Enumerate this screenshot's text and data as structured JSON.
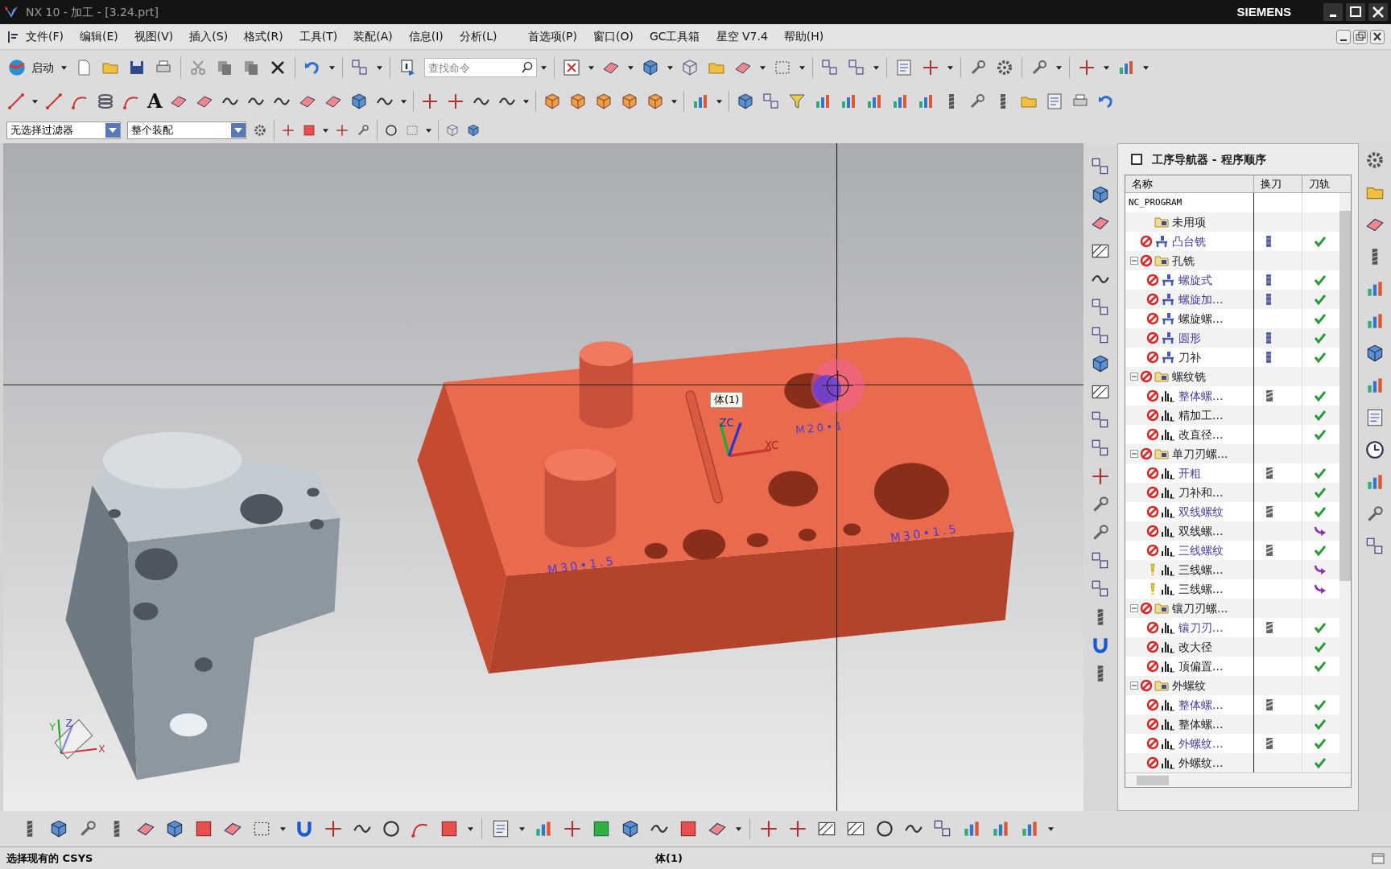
{
  "window": {
    "title": "NX 10 - 加工 - [3.24.prt]",
    "brand": "SIEMENS"
  },
  "menu": [
    "文件(F)",
    "编辑(E)",
    "视图(V)",
    "插入(S)",
    "格式(R)",
    "工具(T)",
    "装配(A)",
    "信息(I)",
    "分析(L)",
    "首选项(P)",
    "窗口(O)",
    "GC工具箱",
    "星空 V7.4",
    "帮助(H)"
  ],
  "toolbar": {
    "start_button": "启动",
    "search": {
      "placeholder": "查找命令"
    },
    "text_tool": "A"
  },
  "selection_bar": {
    "filter": "无选择过滤器",
    "scope": "整个装配"
  },
  "viewport": {
    "tooltip": "体(1)",
    "thread_labels": [
      "M30•1.5",
      "M20•1",
      "M30•1.5"
    ],
    "wcs_labels": [
      "ZC",
      "XC"
    ],
    "triad_labels": [
      "Z",
      "Y",
      "X"
    ]
  },
  "navigator": {
    "title": "工序导航器 - 程序顺序",
    "columns": [
      "名称",
      "换刀",
      "刀轨"
    ],
    "tree": [
      {
        "name": "NC_PROGRAM",
        "kind": "root",
        "children": [
          {
            "name": "未用项",
            "kind": "group",
            "error": false,
            "warning": false,
            "color": "#222222"
          },
          {
            "name": "凸台铣",
            "kind": "mill",
            "error": true,
            "warning": false,
            "tool_change": true,
            "path_ok": true,
            "color": "#4a3d9c"
          },
          {
            "name": "孔铣",
            "kind": "group",
            "error": true,
            "warning": false,
            "expanded": true,
            "color": "#222222",
            "children": [
              {
                "name": "螺旋式",
                "kind": "mill",
                "error": true,
                "warning": false,
                "tool_change": true,
                "path_ok": true,
                "color": "#4a3d9c"
              },
              {
                "name": "螺旋加...",
                "kind": "mill",
                "error": true,
                "warning": false,
                "tool_change": true,
                "path_ok": true,
                "color": "#4a3d9c"
              },
              {
                "name": "螺旋螺...",
                "kind": "mill",
                "error": true,
                "warning": false,
                "tool_change": false,
                "path_ok": true,
                "color": "#222222"
              },
              {
                "name": "圆形",
                "kind": "mill",
                "error": true,
                "warning": false,
                "tool_change": true,
                "path_ok": true,
                "color": "#4a3d9c"
              },
              {
                "name": "刀补",
                "kind": "mill",
                "error": true,
                "warning": false,
                "tool_change": true,
                "path_ok": true,
                "color": "#222222"
              }
            ]
          },
          {
            "name": "螺纹铣",
            "kind": "group",
            "error": true,
            "warning": false,
            "expanded": true,
            "color": "#222222",
            "children": [
              {
                "name": "整体螺...",
                "kind": "thread",
                "error": true,
                "warning": false,
                "tool_change": true,
                "path_ok": true,
                "color": "#4a3d9c"
              },
              {
                "name": "精加工...",
                "kind": "thread",
                "error": true,
                "warning": false,
                "tool_change": false,
                "path_ok": true,
                "color": "#222222"
              },
              {
                "name": "改直径...",
                "kind": "thread",
                "error": true,
                "warning": false,
                "tool_change": false,
                "path_ok": true,
                "color": "#222222"
              }
            ]
          },
          {
            "name": "单刀刃螺...",
            "kind": "group",
            "error": true,
            "warning": false,
            "expanded": true,
            "color": "#222222",
            "children": [
              {
                "name": "开粗",
                "kind": "thread",
                "error": true,
                "warning": false,
                "tool_change": true,
                "path_ok": true,
                "color": "#4a3d9c"
              },
              {
                "name": "刀补和...",
                "kind": "thread",
                "error": true,
                "warning": false,
                "tool_change": false,
                "path_ok": true,
                "color": "#222222"
              },
              {
                "name": "双线螺纹",
                "kind": "thread",
                "error": true,
                "warning": false,
                "tool_change": true,
                "path_ok": true,
                "color": "#4a3d9c"
              },
              {
                "name": "双线螺...",
                "kind": "thread",
                "error": true,
                "warning": false,
                "tool_change": false,
                "path_ok": false,
                "color": "#222222"
              },
              {
                "name": "三线螺纹",
                "kind": "thread",
                "error": true,
                "warning": false,
                "tool_change": true,
                "path_ok": true,
                "color": "#4a3d9c"
              },
              {
                "name": "三线螺...",
                "kind": "thread",
                "error": false,
                "warning": true,
                "tool_change": false,
                "path_ok": false,
                "color": "#222222"
              },
              {
                "name": "三线螺...",
                "kind": "thread",
                "error": false,
                "warning": true,
                "tool_change": false,
                "path_ok": false,
                "color": "#222222"
              }
            ]
          },
          {
            "name": "镶刀刃螺...",
            "kind": "group",
            "error": true,
            "warning": false,
            "expanded": true,
            "color": "#222222",
            "children": [
              {
                "name": "镶刀刃...",
                "kind": "thread",
                "error": true,
                "warning": false,
                "tool_change": true,
                "path_ok": true,
                "color": "#4a3d9c"
              },
              {
                "name": "改大径",
                "kind": "thread",
                "error": true,
                "warning": false,
                "tool_change": false,
                "path_ok": true,
                "color": "#222222"
              },
              {
                "name": "顶偏置...",
                "kind": "thread",
                "error": true,
                "warning": false,
                "tool_change": false,
                "path_ok": true,
                "color": "#222222"
              }
            ]
          },
          {
            "name": "外螺纹",
            "kind": "group",
            "error": true,
            "warning": false,
            "expanded": true,
            "color": "#222222",
            "children": [
              {
                "name": "整体螺...",
                "kind": "thread",
                "error": true,
                "warning": false,
                "tool_change": true,
                "path_ok": true,
                "color": "#4a3d9c"
              },
              {
                "name": "整体螺...",
                "kind": "thread",
                "error": true,
                "warning": false,
                "tool_change": false,
                "path_ok": true,
                "color": "#222222"
              },
              {
                "name": "外螺纹...",
                "kind": "thread",
                "error": true,
                "warning": false,
                "tool_change": true,
                "path_ok": true,
                "color": "#4a3d9c"
              },
              {
                "name": "外螺纹...",
                "kind": "thread",
                "error": true,
                "warning": false,
                "tool_change": false,
                "path_ok": true,
                "color": "#222222"
              }
            ]
          }
        ]
      }
    ]
  },
  "status_bar": {
    "prompt": "选择现有的 CSYS",
    "selection": "体(1)"
  }
}
